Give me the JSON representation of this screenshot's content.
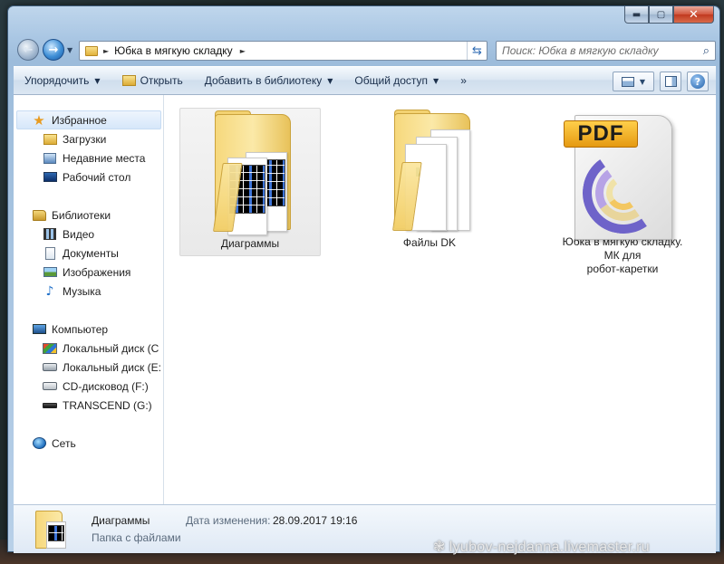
{
  "window": {
    "caption": {
      "minimize": "▬",
      "maximize": "▢",
      "close": "✕"
    }
  },
  "navigation": {
    "back_glyph": "←",
    "forward_glyph": "→",
    "dropdown_glyph": "▼",
    "breadcrumb_separator": "►",
    "breadcrumbs": [
      "Юбка в мягкую складку"
    ],
    "refresh_glyph": "⇆",
    "search_placeholder": "Поиск: Юбка в мягкую складку",
    "search_icon": "search-icon"
  },
  "toolbar": {
    "organize": "Упорядочить",
    "open": "Открыть",
    "add_to_library": "Добавить в библиотеку",
    "share": "Общий доступ",
    "more": "»",
    "dropdown_arrow": "▼",
    "help": "?"
  },
  "sidebar": {
    "favorites": {
      "label": "Избранное",
      "items": [
        {
          "label": "Загрузки",
          "icon": "downloads-icon"
        },
        {
          "label": "Недавние места",
          "icon": "recent-places-icon"
        },
        {
          "label": "Рабочий стол",
          "icon": "desktop-icon"
        }
      ]
    },
    "libraries": {
      "label": "Библиотеки",
      "items": [
        {
          "label": "Видео",
          "icon": "video-icon"
        },
        {
          "label": "Документы",
          "icon": "documents-icon"
        },
        {
          "label": "Изображения",
          "icon": "pictures-icon"
        },
        {
          "label": "Музыка",
          "icon": "music-icon"
        }
      ]
    },
    "computer": {
      "label": "Компьютер",
      "items": [
        {
          "label": "Локальный диск (C",
          "icon": "system-drive-icon"
        },
        {
          "label": "Локальный диск (E:",
          "icon": "drive-icon"
        },
        {
          "label": "CD-дисковод (F:)",
          "icon": "cd-drive-icon"
        },
        {
          "label": "TRANSCEND (G:)",
          "icon": "usb-drive-icon"
        }
      ]
    },
    "network": {
      "label": "Сеть"
    }
  },
  "files": [
    {
      "name": "Диаграммы",
      "type": "folder",
      "selected": true
    },
    {
      "name": "Файлы DK",
      "type": "folder",
      "selected": false
    },
    {
      "name_lines": [
        "Юбка в мягкую складку.",
        "МК для",
        "робот-каретки"
      ],
      "type": "pdf",
      "badge": "PDF",
      "selected": false
    }
  ],
  "details": {
    "name": "Диаграммы",
    "type": "Папка с файлами",
    "modified_label": "Дата изменения:",
    "modified_value": "28.09.2017 19:16"
  },
  "watermark": {
    "flake": "❃",
    "text": "lyubov-nejdanna.livemaster.ru"
  }
}
